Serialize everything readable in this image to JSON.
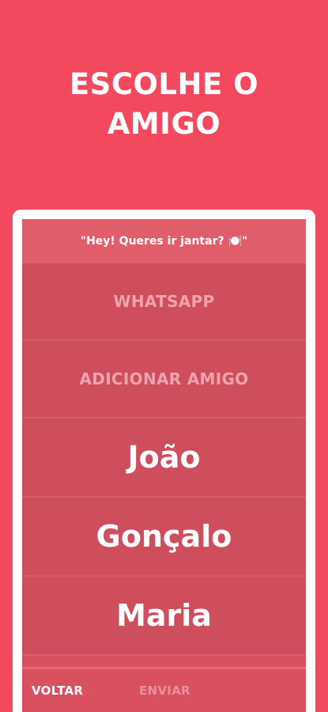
{
  "header": {
    "title_line1": "ESCOLHE O",
    "title_line2": "AMIGO"
  },
  "message": {
    "text": "\"Hey! Queres ir jantar? 🍽️\""
  },
  "options": {
    "whatsapp": "WHATSAPP",
    "add_friend": "ADICIONAR AMIGO"
  },
  "friends": [
    {
      "name": "João"
    },
    {
      "name": "Gonçalo"
    },
    {
      "name": "Maria"
    }
  ],
  "footer": {
    "back_label": "VOLTAR",
    "send_label": "ENVIAR"
  },
  "colors": {
    "background": "#f2495f",
    "panel": "#d95060",
    "accent_text": "#ffffff"
  }
}
